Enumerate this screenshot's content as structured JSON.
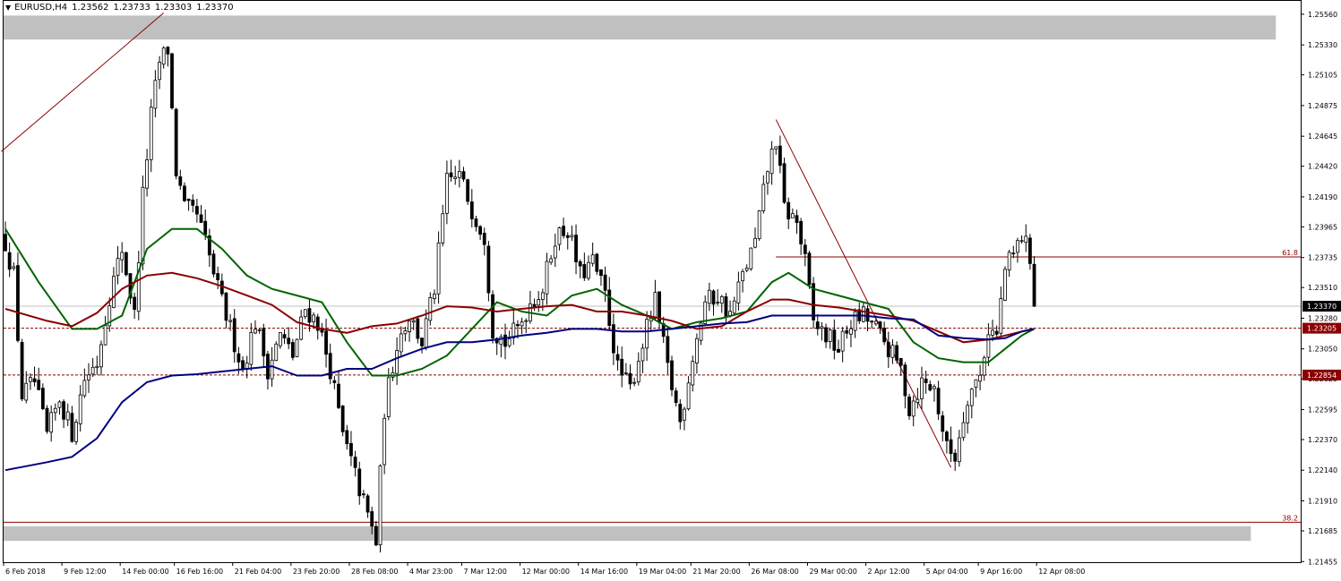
{
  "header": {
    "symbol": "EURUSD,H4",
    "open": "1.23562",
    "high": "1.23733",
    "low": "1.23303",
    "close": "1.23370"
  },
  "chart_data": {
    "type": "candlestick",
    "symbol": "EURUSD",
    "timeframe": "H4",
    "y_range": [
      1.2145,
      1.2566
    ],
    "y_ticks": [
      "1.25560",
      "1.25330",
      "1.25105",
      "1.24875",
      "1.24645",
      "1.24420",
      "1.24190",
      "1.23965",
      "1.23735",
      "1.23510",
      "1.23280",
      "1.23050",
      "1.22825",
      "1.22595",
      "1.22370",
      "1.22140",
      "1.21910",
      "1.21685",
      "1.21455"
    ],
    "x_ticks": [
      "6 Feb 2018",
      "9 Feb 12:00",
      "14 Feb 00:00",
      "16 Feb 16:00",
      "21 Feb 04:00",
      "23 Feb 20:00",
      "28 Feb 08:00",
      "4 Mar 23:00",
      "7 Mar 12:00",
      "12 Mar 00:00",
      "14 Mar 16:00",
      "19 Mar 04:00",
      "21 Mar 20:00",
      "26 Mar 08:00",
      "29 Mar 00:00",
      "2 Apr 12:00",
      "5 Apr 04:00",
      "9 Apr 16:00",
      "12 Apr 08:00"
    ],
    "price_badges": [
      {
        "label": "1.23370",
        "value": 1.2337,
        "bg": "#000000",
        "fg": "#ffffff"
      },
      {
        "label": "1.23205",
        "value": 1.23205,
        "bg": "#8b0000",
        "fg": "#ffffff"
      },
      {
        "label": "1.22854",
        "value": 1.22854,
        "bg": "#8b0000",
        "fg": "#ffffff"
      }
    ],
    "fib_levels": [
      {
        "label": "61.8",
        "value": 1.2374
      },
      {
        "label": "38.2",
        "value": 1.2175
      }
    ],
    "dashed_levels": [
      1.23205,
      1.22854
    ],
    "current_price": 1.2337,
    "zones": [
      {
        "low": 1.2537,
        "high": 1.2555,
        "end_index": 305
      },
      {
        "low": 1.2161,
        "high": 1.2172,
        "end_index": 299
      }
    ],
    "trendlines": [
      {
        "from": [
          -1,
          1.2453
        ],
        "to": [
          38,
          1.2557
        ]
      },
      {
        "from": [
          185,
          1.2477
        ],
        "to": [
          227,
          1.2216
        ]
      }
    ],
    "candles_count": 248,
    "anchors": [
      [
        0,
        1.2385
      ],
      [
        2,
        1.236
      ],
      [
        4,
        1.227
      ],
      [
        7,
        1.228
      ],
      [
        10,
        1.224
      ],
      [
        13,
        1.2268
      ],
      [
        16,
        1.2242
      ],
      [
        19,
        1.2283
      ],
      [
        22,
        1.2295
      ],
      [
        25,
        1.2345
      ],
      [
        28,
        1.238
      ],
      [
        31,
        1.233
      ],
      [
        33,
        1.242
      ],
      [
        35,
        1.248
      ],
      [
        37,
        1.252
      ],
      [
        39,
        1.253
      ],
      [
        41,
        1.2438
      ],
      [
        43,
        1.241
      ],
      [
        46,
        1.2405
      ],
      [
        48,
        1.2385
      ],
      [
        51,
        1.235
      ],
      [
        54,
        1.232
      ],
      [
        57,
        1.229
      ],
      [
        60,
        1.2325
      ],
      [
        63,
        1.229
      ],
      [
        66,
        1.2315
      ],
      [
        69,
        1.23
      ],
      [
        72,
        1.2335
      ],
      [
        75,
        1.2325
      ],
      [
        78,
        1.229
      ],
      [
        81,
        1.224
      ],
      [
        84,
        1.221
      ],
      [
        87,
        1.218
      ],
      [
        89,
        1.216
      ],
      [
        91,
        1.226
      ],
      [
        94,
        1.231
      ],
      [
        97,
        1.233
      ],
      [
        100,
        1.231
      ],
      [
        103,
        1.235
      ],
      [
        106,
        1.243
      ],
      [
        109,
        1.2435
      ],
      [
        112,
        1.241
      ],
      [
        115,
        1.239
      ],
      [
        117,
        1.232
      ],
      [
        120,
        1.231
      ],
      [
        123,
        1.232
      ],
      [
        126,
        1.234
      ],
      [
        129,
        1.235
      ],
      [
        132,
        1.239
      ],
      [
        135,
        1.2395
      ],
      [
        138,
        1.236
      ],
      [
        141,
        1.237
      ],
      [
        144,
        1.2345
      ],
      [
        147,
        1.229
      ],
      [
        150,
        1.2275
      ],
      [
        153,
        1.231
      ],
      [
        156,
        1.234
      ],
      [
        159,
        1.229
      ],
      [
        162,
        1.225
      ],
      [
        165,
        1.23
      ],
      [
        168,
        1.234
      ],
      [
        171,
        1.2345
      ],
      [
        174,
        1.233
      ],
      [
        177,
        1.236
      ],
      [
        180,
        1.2385
      ],
      [
        183,
        1.244
      ],
      [
        185,
        1.2462
      ],
      [
        187,
        1.241
      ],
      [
        190,
        1.24
      ],
      [
        192,
        1.237
      ],
      [
        194,
        1.2325
      ],
      [
        197,
        1.2315
      ],
      [
        200,
        1.2305
      ],
      [
        203,
        1.2325
      ],
      [
        206,
        1.233
      ],
      [
        209,
        1.232
      ],
      [
        212,
        1.2305
      ],
      [
        215,
        1.229
      ],
      [
        217,
        1.226
      ],
      [
        220,
        1.228
      ],
      [
        223,
        1.2275
      ],
      [
        226,
        1.223
      ],
      [
        228,
        1.2225
      ],
      [
        231,
        1.227
      ],
      [
        234,
        1.2285
      ],
      [
        236,
        1.232
      ],
      [
        238,
        1.2315
      ],
      [
        240,
        1.2365
      ],
      [
        242,
        1.2375
      ],
      [
        244,
        1.239
      ],
      [
        246,
        1.2375
      ],
      [
        247,
        1.2337
      ]
    ],
    "moving_averages": [
      {
        "color": "#006400",
        "period": 34,
        "label": "",
        "points": [
          [
            0,
            1.2395
          ],
          [
            8,
            1.2355
          ],
          [
            16,
            1.232
          ],
          [
            22,
            1.232
          ],
          [
            28,
            1.233
          ],
          [
            34,
            1.238
          ],
          [
            40,
            1.2395
          ],
          [
            46,
            1.2395
          ],
          [
            52,
            1.238
          ],
          [
            58,
            1.236
          ],
          [
            64,
            1.235
          ],
          [
            70,
            1.2345
          ],
          [
            76,
            1.234
          ],
          [
            82,
            1.231
          ],
          [
            88,
            1.2285
          ],
          [
            94,
            1.2285
          ],
          [
            100,
            1.229
          ],
          [
            106,
            1.23
          ],
          [
            112,
            1.232
          ],
          [
            118,
            1.234
          ],
          [
            124,
            1.2333
          ],
          [
            130,
            1.233
          ],
          [
            136,
            1.2345
          ],
          [
            142,
            1.235
          ],
          [
            148,
            1.2338
          ],
          [
            154,
            1.233
          ],
          [
            160,
            1.232
          ],
          [
            166,
            1.2325
          ],
          [
            172,
            1.2328
          ],
          [
            178,
            1.2333
          ],
          [
            184,
            1.2355
          ],
          [
            188,
            1.2362
          ],
          [
            194,
            1.235
          ],
          [
            200,
            1.2345
          ],
          [
            206,
            1.234
          ],
          [
            212,
            1.2335
          ],
          [
            218,
            1.231
          ],
          [
            224,
            1.2298
          ],
          [
            230,
            1.2295
          ],
          [
            236,
            1.2295
          ],
          [
            240,
            1.2305
          ],
          [
            244,
            1.2315
          ],
          [
            247,
            1.232
          ]
        ]
      },
      {
        "color": "#8b0000",
        "period": 100,
        "label": "",
        "points": [
          [
            0,
            1.2335
          ],
          [
            10,
            1.2326
          ],
          [
            16,
            1.2322
          ],
          [
            22,
            1.2332
          ],
          [
            28,
            1.235
          ],
          [
            34,
            1.236
          ],
          [
            40,
            1.2362
          ],
          [
            46,
            1.2358
          ],
          [
            52,
            1.2352
          ],
          [
            58,
            1.2345
          ],
          [
            64,
            1.2338
          ],
          [
            70,
            1.2325
          ],
          [
            76,
            1.232
          ],
          [
            82,
            1.2317
          ],
          [
            88,
            1.2322
          ],
          [
            94,
            1.2324
          ],
          [
            100,
            1.233
          ],
          [
            106,
            1.2337
          ],
          [
            112,
            1.2336
          ],
          [
            118,
            1.2333
          ],
          [
            124,
            1.2335
          ],
          [
            130,
            1.2337
          ],
          [
            136,
            1.2338
          ],
          [
            142,
            1.2333
          ],
          [
            148,
            1.2333
          ],
          [
            154,
            1.233
          ],
          [
            160,
            1.2326
          ],
          [
            166,
            1.232
          ],
          [
            172,
            1.2322
          ],
          [
            178,
            1.2333
          ],
          [
            184,
            1.2342
          ],
          [
            188,
            1.2342
          ],
          [
            194,
            1.2338
          ],
          [
            200,
            1.2336
          ],
          [
            206,
            1.2333
          ],
          [
            212,
            1.233
          ],
          [
            218,
            1.2326
          ],
          [
            224,
            1.2318
          ],
          [
            230,
            1.231
          ],
          [
            236,
            1.2312
          ],
          [
            240,
            1.2315
          ],
          [
            244,
            1.2318
          ],
          [
            247,
            1.232
          ]
        ]
      },
      {
        "color": "#000080",
        "period": 200,
        "label": "",
        "points": [
          [
            0,
            1.2214
          ],
          [
            10,
            1.222
          ],
          [
            16,
            1.2224
          ],
          [
            22,
            1.2238
          ],
          [
            28,
            1.2265
          ],
          [
            34,
            1.228
          ],
          [
            40,
            1.2285
          ],
          [
            46,
            1.2286
          ],
          [
            52,
            1.2288
          ],
          [
            58,
            1.229
          ],
          [
            64,
            1.2292
          ],
          [
            70,
            1.2285
          ],
          [
            76,
            1.2285
          ],
          [
            82,
            1.229
          ],
          [
            88,
            1.229
          ],
          [
            94,
            1.2298
          ],
          [
            100,
            1.2305
          ],
          [
            106,
            1.231
          ],
          [
            112,
            1.231
          ],
          [
            118,
            1.2312
          ],
          [
            124,
            1.2315
          ],
          [
            130,
            1.2317
          ],
          [
            136,
            1.232
          ],
          [
            142,
            1.232
          ],
          [
            148,
            1.2318
          ],
          [
            154,
            1.2318
          ],
          [
            160,
            1.232
          ],
          [
            166,
            1.2322
          ],
          [
            172,
            1.2324
          ],
          [
            178,
            1.2325
          ],
          [
            184,
            1.233
          ],
          [
            188,
            1.233
          ],
          [
            194,
            1.233
          ],
          [
            200,
            1.233
          ],
          [
            206,
            1.233
          ],
          [
            212,
            1.2328
          ],
          [
            218,
            1.2327
          ],
          [
            224,
            1.2315
          ],
          [
            230,
            1.2313
          ],
          [
            236,
            1.2312
          ],
          [
            240,
            1.2313
          ],
          [
            244,
            1.2318
          ],
          [
            247,
            1.232
          ]
        ]
      }
    ],
    "colors": {
      "bull": "#ffffff",
      "bear": "#000000",
      "wick": "#000000",
      "grid": "#c0c0c0",
      "current_line": "#c0c0c0",
      "fib": "#8b0000",
      "zone": "#c0c0c0"
    }
  }
}
